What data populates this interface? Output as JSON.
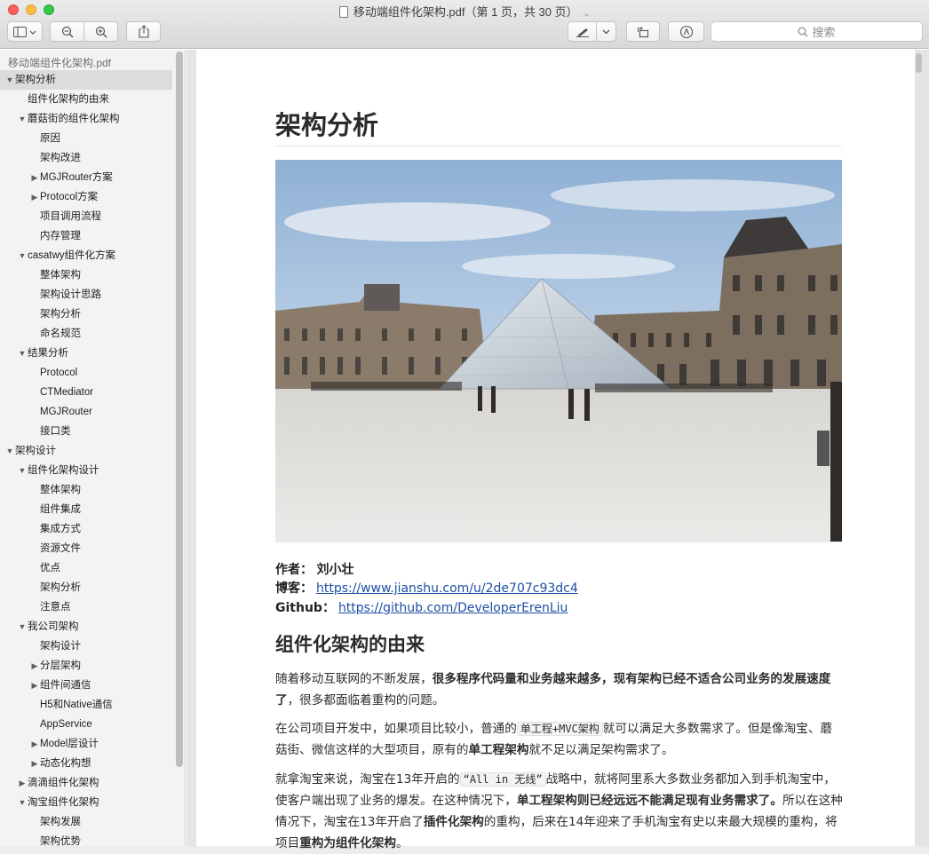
{
  "window": {
    "title": "移动端组件化架构.pdf（第 1 页，共 30 页）"
  },
  "toolbar": {
    "search_placeholder": "搜索"
  },
  "sidebar": {
    "file_name": "移动端组件化架构.pdf",
    "items": [
      {
        "label": "架构分析",
        "level": 0,
        "toggle": "open",
        "selected": true
      },
      {
        "label": "组件化架构的由来",
        "level": 1,
        "toggle": "none"
      },
      {
        "label": "蘑菇街的组件化架构",
        "level": 1,
        "toggle": "open"
      },
      {
        "label": "原因",
        "level": 2,
        "toggle": "none"
      },
      {
        "label": "架构改进",
        "level": 2,
        "toggle": "none"
      },
      {
        "label": "MGJRouter方案",
        "level": 2,
        "toggle": "closed"
      },
      {
        "label": "Protocol方案",
        "level": 2,
        "toggle": "closed"
      },
      {
        "label": "项目调用流程",
        "level": 2,
        "toggle": "none"
      },
      {
        "label": "内存管理",
        "level": 2,
        "toggle": "none"
      },
      {
        "label": "casatwy组件化方案",
        "level": 1,
        "toggle": "open"
      },
      {
        "label": "整体架构",
        "level": 2,
        "toggle": "none"
      },
      {
        "label": "架构设计思路",
        "level": 2,
        "toggle": "none"
      },
      {
        "label": "架构分析",
        "level": 2,
        "toggle": "none"
      },
      {
        "label": "命名规范",
        "level": 2,
        "toggle": "none"
      },
      {
        "label": "结果分析",
        "level": 1,
        "toggle": "open"
      },
      {
        "label": "Protocol",
        "level": 2,
        "toggle": "none"
      },
      {
        "label": "CTMediator",
        "level": 2,
        "toggle": "none"
      },
      {
        "label": "MGJRouter",
        "level": 2,
        "toggle": "none"
      },
      {
        "label": "接口类",
        "level": 2,
        "toggle": "none"
      },
      {
        "label": "架构设计",
        "level": 0,
        "toggle": "open"
      },
      {
        "label": "组件化架构设计",
        "level": 1,
        "toggle": "open"
      },
      {
        "label": "整体架构",
        "level": 2,
        "toggle": "none"
      },
      {
        "label": "组件集成",
        "level": 2,
        "toggle": "none"
      },
      {
        "label": "集成方式",
        "level": 2,
        "toggle": "none"
      },
      {
        "label": "资源文件",
        "level": 2,
        "toggle": "none"
      },
      {
        "label": "优点",
        "level": 2,
        "toggle": "none"
      },
      {
        "label": "架构分析",
        "level": 2,
        "toggle": "none"
      },
      {
        "label": "注意点",
        "level": 2,
        "toggle": "none"
      },
      {
        "label": "我公司架构",
        "level": 1,
        "toggle": "open"
      },
      {
        "label": "架构设计",
        "level": 2,
        "toggle": "none"
      },
      {
        "label": "分层架构",
        "level": 2,
        "toggle": "closed"
      },
      {
        "label": "组件间通信",
        "level": 2,
        "toggle": "closed"
      },
      {
        "label": "H5和Native通信",
        "level": 2,
        "toggle": "none"
      },
      {
        "label": "AppService",
        "level": 2,
        "toggle": "none"
      },
      {
        "label": "Model层设计",
        "level": 2,
        "toggle": "closed"
      },
      {
        "label": "动态化构想",
        "level": 2,
        "toggle": "closed"
      },
      {
        "label": "滴滴组件化架构",
        "level": 1,
        "toggle": "closed"
      },
      {
        "label": "淘宝组件化架构",
        "level": 1,
        "toggle": "open"
      },
      {
        "label": "架构发展",
        "level": 2,
        "toggle": "none"
      },
      {
        "label": "架构优势",
        "level": 2,
        "toggle": "none"
      }
    ]
  },
  "document": {
    "heading": "架构分析",
    "image_alt": "卢浮宫玻璃金字塔",
    "author_label": "作者：",
    "author": "刘小壮",
    "blog_label": "博客：",
    "blog_url": "https://www.jianshu.com/u/2de707c93dc4",
    "github_label": "Github：",
    "github_url": "https://github.com/DeveloperErenLiu",
    "section_heading": "组件化架构的由来",
    "p1": {
      "s1": "随着移动互联网的不断发展，",
      "s2": "很多程序代码量和业务越来越多，现有架构已经不适合公司业务的发展速度了",
      "s3": "，很多都面临着重构的问题。"
    },
    "p2": {
      "s1": "在公司项目开发中，如果项目比较小，普通的",
      "code": "单工程+MVC架构",
      "s2": "就可以满足大多数需求了。但是像淘宝、蘑菇街、微信这样的大型项目，原有的",
      "b1": "单工程架构",
      "s3": "就不足以满足架构需求了。"
    },
    "p3": {
      "s1": "就拿淘宝来说，淘宝在13年开启的",
      "code": "“All in 无线”",
      "s2": "战略中，就将阿里系大多数业务都加入到手机淘宝中，使客户端出现了业务的爆发。在这种情况下，",
      "b1": "单工程架构则已经远远不能满足现有业务需求了。",
      "s3": "所以在这种情况下，淘宝在13年开启了",
      "b2": "插件化架构",
      "s4": "的重构，后来在14年迎来了手机淘宝有史以来最大规模的重构，将项目",
      "b3": "重构为组件化架构",
      "s5": "。"
    }
  },
  "colors": {
    "link": "#1d4fa3",
    "sidebar_selected": "#dcdcdc",
    "sidebar_bg": "#f3f3f3"
  }
}
